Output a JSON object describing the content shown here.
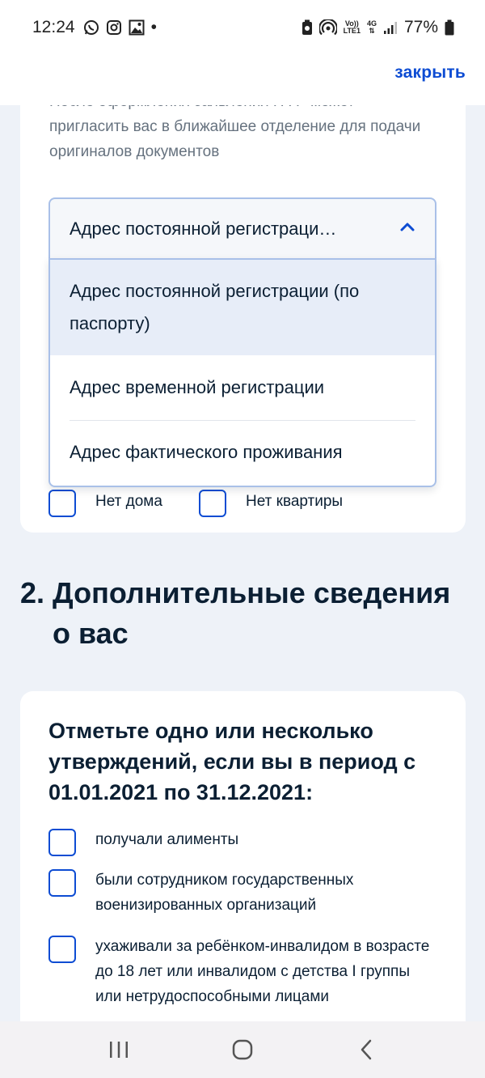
{
  "status_bar": {
    "time": "12:24",
    "notification_icons": [
      "whatsapp-icon",
      "instagram-icon",
      "gallery-icon"
    ],
    "dot": "•",
    "volte_label": "Vo))",
    "lte_label": "LTE1",
    "network_label": "4G",
    "battery_percent": "77%"
  },
  "header": {
    "close_label": "закрыть"
  },
  "card1": {
    "intro_text": "После оформления заявления ПФР может пригласить вас в ближайшее отделение для подачи оригиналов документов",
    "select": {
      "value": "Адрес постоянной регистраци…",
      "options": [
        "Адрес постоянной регистрации (по паспорту)",
        "Адрес временной регистрации",
        "Адрес фактического проживания"
      ],
      "selected_index": 0
    },
    "checkboxes": [
      {
        "label": "Нет дома",
        "checked": false
      },
      {
        "label": "Нет квартиры",
        "checked": false
      }
    ]
  },
  "section2": {
    "number": "2.",
    "title": "Дополнительные сведения о вас"
  },
  "card2": {
    "title": "Отметьте одно или несколько утверждений, если вы в период с 01.01.2021 по 31.12.2021:",
    "options": [
      {
        "text": "получали алименты",
        "checked": false
      },
      {
        "text": "были сотрудником государственных военизированных организаций",
        "checked": false
      },
      {
        "text": "ухаживали за ребёнком-инвалидом в возрасте до 18 лет или инвалидом с детства I группы или нетрудоспособными лицами",
        "checked": false
      }
    ]
  },
  "colors": {
    "accent": "#0d4cd3",
    "background": "#eef2f8",
    "selected_option": "#e7edf8",
    "muted_text": "#66727f"
  }
}
